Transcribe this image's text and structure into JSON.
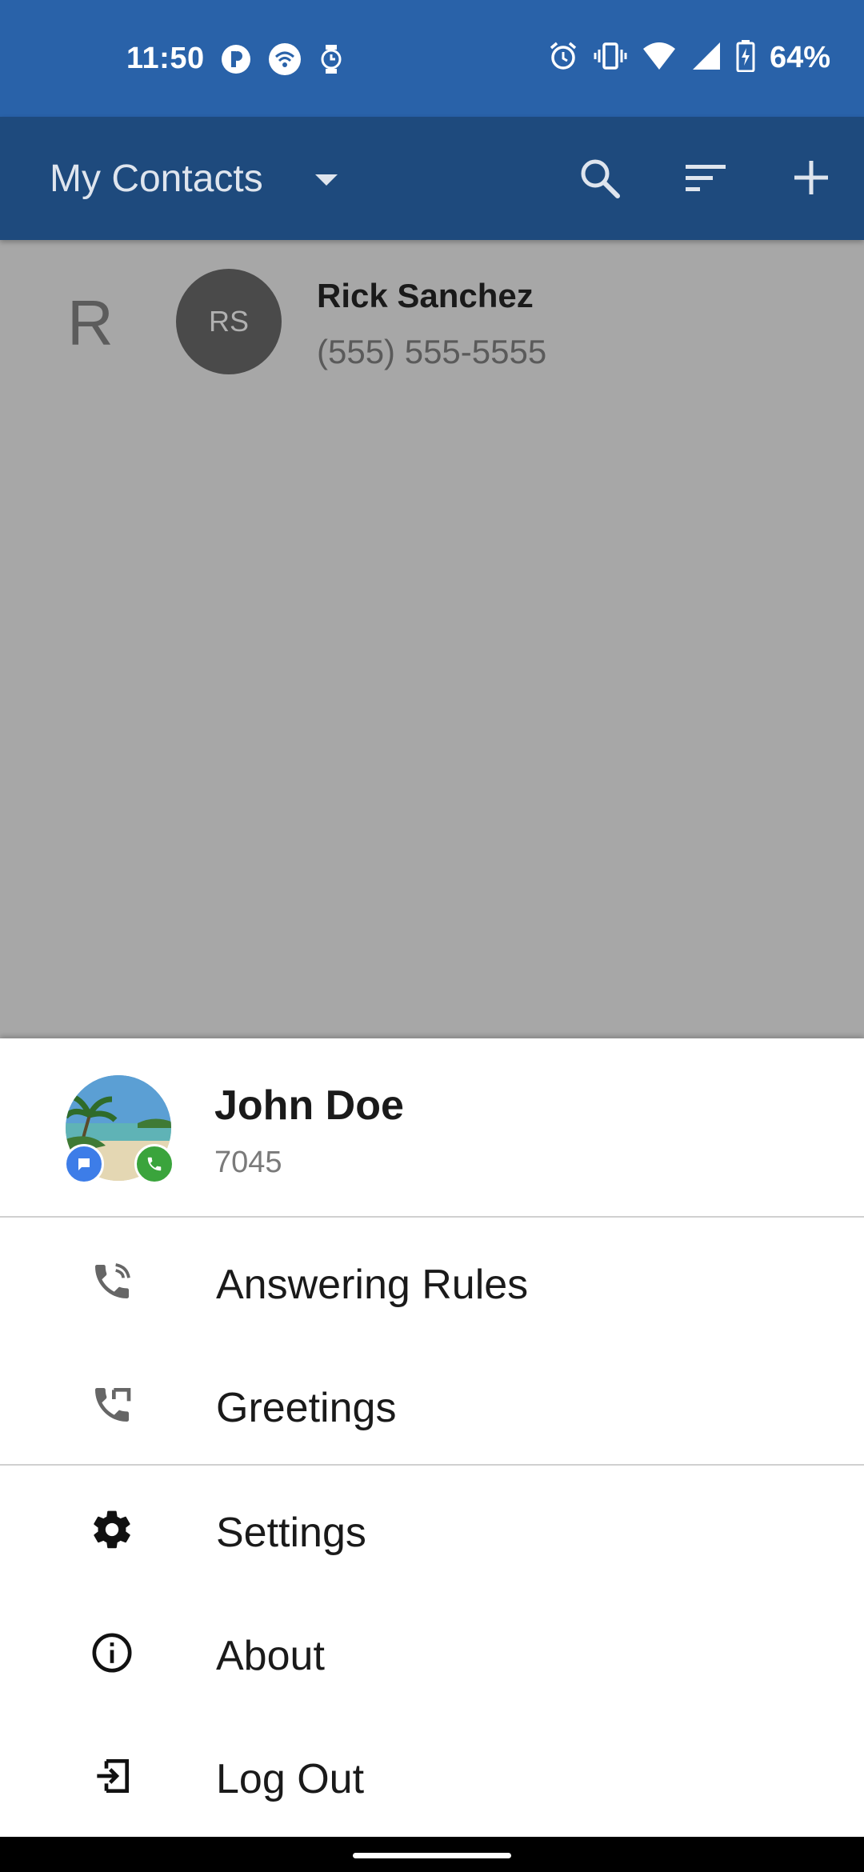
{
  "status_bar": {
    "time": "11:50",
    "battery": "64%",
    "icons": [
      "app-notification-icon",
      "wifi-hotspot-icon",
      "watch-icon",
      "alarm-icon",
      "vibrate-icon",
      "wifi-icon",
      "signal-icon",
      "battery-charging-icon"
    ]
  },
  "app_bar": {
    "title": "My Contacts",
    "icons": [
      "dropdown-arrow-icon",
      "search-icon",
      "sort-icon",
      "add-icon"
    ]
  },
  "contacts": {
    "section_letter": "R",
    "items": [
      {
        "initials": "RS",
        "name": "Rick Sanchez",
        "phone": "(555) 555-5555"
      }
    ]
  },
  "drawer": {
    "profile": {
      "name": "John Doe",
      "extension": "7045"
    },
    "menu": [
      {
        "label": "Answering Rules",
        "icon": "call-forward-icon"
      },
      {
        "label": "Greetings",
        "icon": "call-greeting-icon"
      },
      {
        "label": "Settings",
        "icon": "gear-icon"
      },
      {
        "label": "About",
        "icon": "info-icon"
      },
      {
        "label": "Log Out",
        "icon": "logout-icon"
      }
    ]
  },
  "colors": {
    "status_bar": "#2962a9",
    "app_bar": "#1e4a7d",
    "scrim": "#a7a7a7",
    "message_badge": "#3d7de8",
    "call_badge": "#3aa43c"
  }
}
